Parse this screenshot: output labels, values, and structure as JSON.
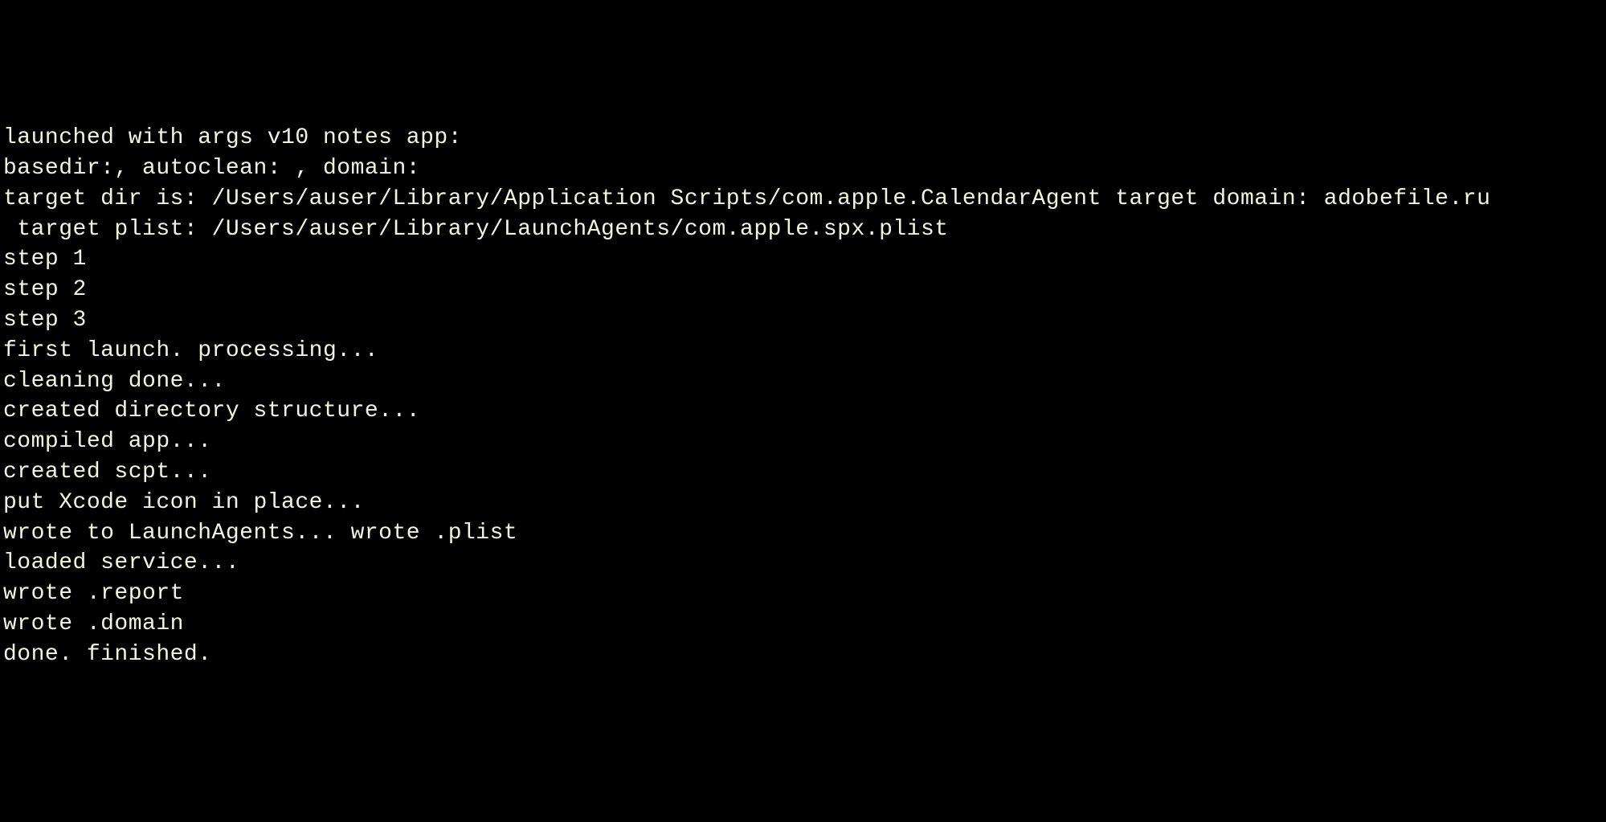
{
  "terminal": {
    "lines": [
      "launched with args v10 notes app:",
      "basedir:, autoclean: , domain:",
      "target dir is: /Users/auser/Library/Application Scripts/com.apple.CalendarAgent target domain: adobefile.ru",
      " target plist: /Users/auser/Library/LaunchAgents/com.apple.spx.plist",
      "step 1",
      "step 2",
      "step 3",
      "first launch. processing...",
      "cleaning done...",
      "created directory structure...",
      "compiled app...",
      "created scpt...",
      "put Xcode icon in place...",
      "wrote to LaunchAgents... wrote .plist",
      "loaded service...",
      "wrote .report",
      "wrote .domain",
      "done. finished."
    ]
  }
}
